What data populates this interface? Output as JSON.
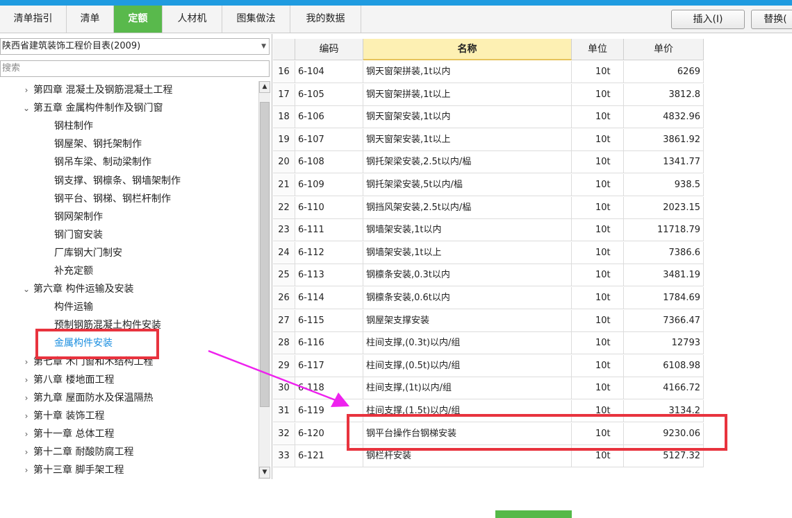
{
  "tabs": [
    "清单指引",
    "清单",
    "定额",
    "人材机",
    "图集做法",
    "我的数据"
  ],
  "active_tab": "定额",
  "toolbar": {
    "insert_label": "插入(I)",
    "replace_label": "替换("
  },
  "left_panel": {
    "combo_value": "陕西省建筑装饰工程价目表(2009)",
    "search_placeholder": "搜索",
    "tree": [
      {
        "label": "第四章 混凝土及钢筋混凝土工程",
        "level": 0,
        "expanded": false
      },
      {
        "label": "第五章 金属构件制作及钢门窗",
        "level": 0,
        "expanded": true
      },
      {
        "label": "钢柱制作",
        "level": 1
      },
      {
        "label": "钢屋架、钢托架制作",
        "level": 1
      },
      {
        "label": "钢吊车梁、制动梁制作",
        "level": 1
      },
      {
        "label": "钢支撑、钢檩条、钢墙架制作",
        "level": 1
      },
      {
        "label": "钢平台、钢梯、钢栏杆制作",
        "level": 1
      },
      {
        "label": "钢网架制作",
        "level": 1
      },
      {
        "label": "钢门窗安装",
        "level": 1
      },
      {
        "label": "厂库钢大门制安",
        "level": 1
      },
      {
        "label": "补充定额",
        "level": 1
      },
      {
        "label": "第六章 构件运输及安装",
        "level": 0,
        "expanded": true
      },
      {
        "label": "构件运输",
        "level": 1
      },
      {
        "label": "预制钢筋混凝土构件安装",
        "level": 1
      },
      {
        "label": "金属构件安装",
        "level": 1,
        "selected": true
      },
      {
        "label": "第七章 木门窗和木结构工程",
        "level": 0,
        "expanded": false
      },
      {
        "label": "第八章 楼地面工程",
        "level": 0,
        "expanded": false
      },
      {
        "label": "第九章 屋面防水及保温隔热",
        "level": 0,
        "expanded": false
      },
      {
        "label": "第十章 装饰工程",
        "level": 0,
        "expanded": false
      },
      {
        "label": "第十一章 总体工程",
        "level": 0,
        "expanded": false
      },
      {
        "label": "第十二章 耐酸防腐工程",
        "level": 0,
        "expanded": false
      },
      {
        "label": "第十三章 脚手架工程",
        "level": 0,
        "expanded": false
      }
    ]
  },
  "grid": {
    "headers": {
      "code": "编码",
      "name": "名称",
      "unit": "单位",
      "price": "单价"
    },
    "rows": [
      {
        "no": "16",
        "code": "6-104",
        "name": "钢天窗架拼装,1t以内",
        "unit": "10t",
        "price": "6269"
      },
      {
        "no": "17",
        "code": "6-105",
        "name": "钢天窗架拼装,1t以上",
        "unit": "10t",
        "price": "3812.8"
      },
      {
        "no": "18",
        "code": "6-106",
        "name": "钢天窗架安装,1t以内",
        "unit": "10t",
        "price": "4832.96"
      },
      {
        "no": "19",
        "code": "6-107",
        "name": "钢天窗架安装,1t以上",
        "unit": "10t",
        "price": "3861.92"
      },
      {
        "no": "20",
        "code": "6-108",
        "name": "钢托架梁安装,2.5t以内/榀",
        "unit": "10t",
        "price": "1341.77"
      },
      {
        "no": "21",
        "code": "6-109",
        "name": "钢托架梁安装,5t以内/榀",
        "unit": "10t",
        "price": "938.5"
      },
      {
        "no": "22",
        "code": "6-110",
        "name": "钢挡风架安装,2.5t以内/榀",
        "unit": "10t",
        "price": "2023.15"
      },
      {
        "no": "23",
        "code": "6-111",
        "name": "钢墙架安装,1t以内",
        "unit": "10t",
        "price": "11718.79"
      },
      {
        "no": "24",
        "code": "6-112",
        "name": "钢墙架安装,1t以上",
        "unit": "10t",
        "price": "7386.6"
      },
      {
        "no": "25",
        "code": "6-113",
        "name": "钢檩条安装,0.3t以内",
        "unit": "10t",
        "price": "3481.19"
      },
      {
        "no": "26",
        "code": "6-114",
        "name": "钢檩条安装,0.6t以内",
        "unit": "10t",
        "price": "1784.69"
      },
      {
        "no": "27",
        "code": "6-115",
        "name": "钢屋架支撑安装",
        "unit": "10t",
        "price": "7366.47"
      },
      {
        "no": "28",
        "code": "6-116",
        "name": "柱间支撑,(0.3t)以内/组",
        "unit": "10t",
        "price": "12793"
      },
      {
        "no": "29",
        "code": "6-117",
        "name": "柱间支撑,(0.5t)以内/组",
        "unit": "10t",
        "price": "6108.98"
      },
      {
        "no": "30",
        "code": "6-118",
        "name": "柱间支撑,(1t)以内/组",
        "unit": "10t",
        "price": "4166.72"
      },
      {
        "no": "31",
        "code": "6-119",
        "name": "柱间支撑,(1.5t)以内/组",
        "unit": "10t",
        "price": "3134.2"
      },
      {
        "no": "32",
        "code": "6-120",
        "name": "钢平台操作台钢梯安装",
        "unit": "10t",
        "price": "9230.06"
      },
      {
        "no": "33",
        "code": "6-121",
        "name": "钢栏杆安装",
        "unit": "10t",
        "price": "5127.32"
      }
    ]
  },
  "colors": {
    "topbar": "#1f9be0",
    "active_tab": "#59b94c",
    "highlight": "#e8333e",
    "arrow": "#ee22ee",
    "selected_text": "#1b8fe0"
  }
}
